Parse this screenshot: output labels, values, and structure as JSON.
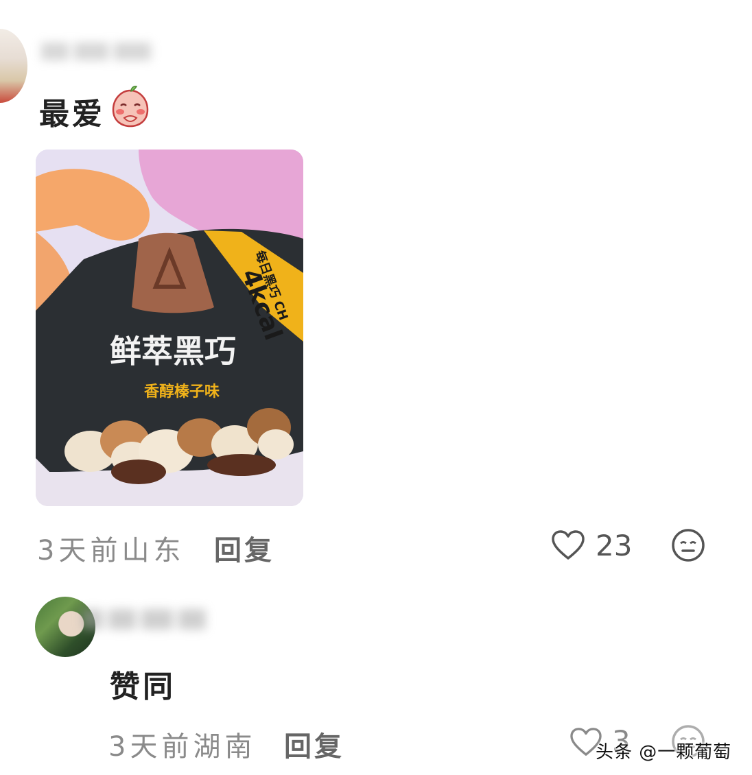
{
  "comments": [
    {
      "text": "最爱",
      "emoji": "blushing-peach-emoji",
      "time": "3天前",
      "location": "山东",
      "reply_label": "回复",
      "likes": "23",
      "product_photo": {
        "brand_text": "鲜萃黑巧",
        "flavor_text": "香醇榛子味",
        "kcal_text": "4kcal",
        "side_text": "每日黑巧 CH"
      }
    },
    {
      "text": "赞同",
      "time": "3天前",
      "location": "湖南",
      "reply_label": "回复",
      "likes": "3"
    }
  ],
  "watermark": "头条 @一颗葡萄",
  "colors": {
    "meta_text": "#8a8a8a",
    "comment_text": "#222222",
    "package_dark": "#2b2f33",
    "package_gold": "#f0b21a"
  },
  "icons": {
    "like": "heart-outline-icon",
    "dislike": "neutral-face-icon"
  }
}
